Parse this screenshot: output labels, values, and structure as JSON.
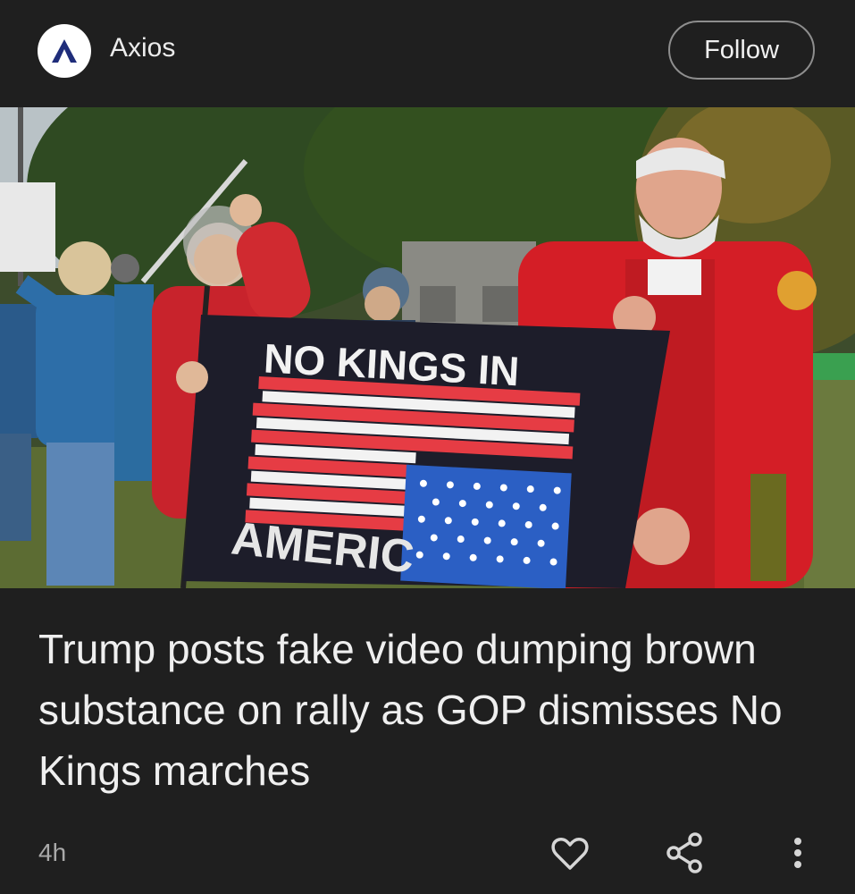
{
  "header": {
    "source_name": "Axios",
    "follow_label": "Follow"
  },
  "photo": {
    "flag_line1": "NO KINGS IN",
    "flag_line2": "AMERIC"
  },
  "article": {
    "headline": "Trump posts fake video dumping brown substance on rally as GOP dismisses No Kings marches",
    "time": "4h"
  },
  "icons": {
    "logo": "axios-logo-icon",
    "like": "heart-icon",
    "share": "share-icon",
    "more": "more-vertical-icon"
  },
  "colors": {
    "background": "#1f1f1f",
    "text": "#efefef",
    "secondary_text": "#a9a9a9"
  }
}
